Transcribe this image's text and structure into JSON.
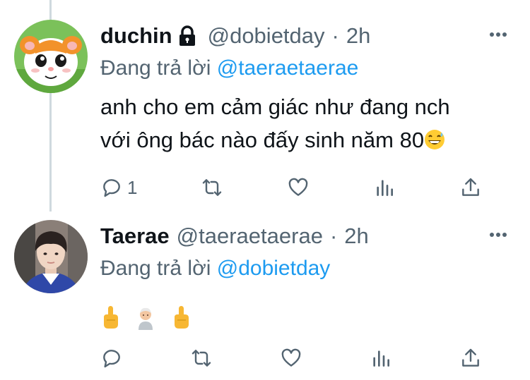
{
  "tweets": [
    {
      "display_name": "duchin",
      "protected": true,
      "handle": "@dobietday",
      "separator": "·",
      "time": "2h",
      "replying_prefix": "Đang trả lời",
      "replying_to": "@taeraetaerae",
      "text_line1": "anh cho em cảm giác như đang nch",
      "text_line2": "với ông bác nào đấy sinh năm 80",
      "inline_emoji": "grinning-sweat-emoji",
      "reply_count": "1",
      "avatar_icon": "hamster-cartoon-avatar"
    },
    {
      "display_name": "Taerae",
      "handle": "@taeraetaerae",
      "separator": "·",
      "time": "2h",
      "replying_prefix": "Đang trả lời",
      "replying_to": "@dobietday",
      "emojis": [
        "middle-finger-emoji",
        "old-man-emoji",
        "middle-finger-emoji"
      ],
      "avatar_icon": "person-photo-avatar"
    }
  ],
  "colors": {
    "link": "#1d9bf0",
    "muted": "#536471",
    "text": "#0f1419",
    "thread_line": "#cfd9de"
  }
}
